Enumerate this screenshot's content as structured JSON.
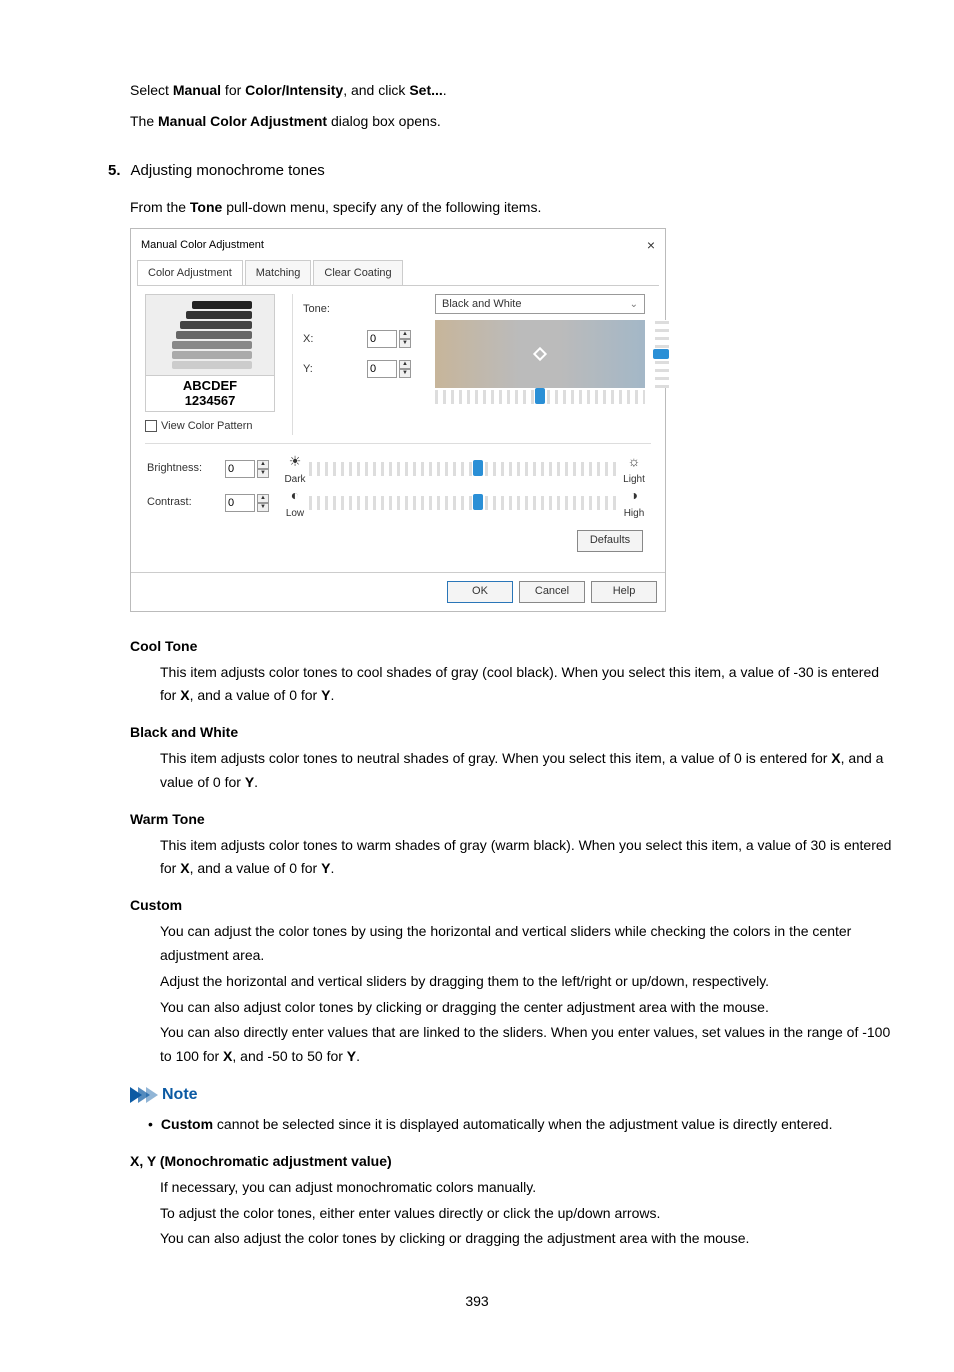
{
  "intro": {
    "line1_pre": "Select ",
    "line1_b1": "Manual",
    "line1_mid": " for ",
    "line1_b2": "Color/Intensity",
    "line1_mid2": ", and click ",
    "line1_b3": "Set...",
    "line1_end": ".",
    "line2_pre": "The ",
    "line2_b1": "Manual Color Adjustment",
    "line2_end": " dialog box opens."
  },
  "step": {
    "num": "5.",
    "title": "Adjusting monochrome tones",
    "desc_pre": "From the ",
    "desc_b": "Tone",
    "desc_end": " pull-down menu, specify any of the following items."
  },
  "dialog": {
    "title": "Manual Color Adjustment",
    "tabs": [
      "Color Adjustment",
      "Matching",
      "Clear Coating"
    ],
    "labels": {
      "tone": "Tone:",
      "x": "X:",
      "y": "Y:",
      "brightness": "Brightness:",
      "contrast": "Contrast:",
      "view_pattern": "View Color Pattern",
      "dark": "Dark",
      "light": "Light",
      "low": "Low",
      "high": "High"
    },
    "tone_value": "Black and White",
    "x_value": "0",
    "y_value": "0",
    "brightness_value": "0",
    "contrast_value": "0",
    "preview_l1": "ABCDEF",
    "preview_l2": "1234567",
    "buttons": {
      "defaults": "Defaults",
      "ok": "OK",
      "cancel": "Cancel",
      "help": "Help"
    }
  },
  "defs": {
    "cool": {
      "term": "Cool Tone",
      "d_pre": "This item adjusts color tones to cool shades of gray (cool black). When you select this item, a value of -30 is entered for ",
      "d_b1": "X",
      "d_mid": ", and a value of 0 for ",
      "d_b2": "Y",
      "d_end": "."
    },
    "bw": {
      "term": "Black and White",
      "d_pre": "This item adjusts color tones to neutral shades of gray. When you select this item, a value of 0 is entered for ",
      "d_b1": "X",
      "d_mid": ", and a value of 0 for ",
      "d_b2": "Y",
      "d_end": "."
    },
    "warm": {
      "term": "Warm Tone",
      "d_pre": "This item adjusts color tones to warm shades of gray (warm black). When you select this item, a value of 30 is entered for ",
      "d_b1": "X",
      "d_mid": ", and a value of 0 for ",
      "d_b2": "Y",
      "d_end": "."
    },
    "custom": {
      "term": "Custom",
      "p1": "You can adjust the color tones by using the horizontal and vertical sliders while checking the colors in the center adjustment area.",
      "p2": "Adjust the horizontal and vertical sliders by dragging them to the left/right or up/down, respectively.",
      "p3": "You can also adjust color tones by clicking or dragging the center adjustment area with the mouse.",
      "p4_pre": "You can also directly enter values that are linked to the sliders. When you enter values, set values in the range of -100 to 100 for ",
      "p4_b1": "X",
      "p4_mid": ", and -50 to 50 for ",
      "p4_b2": "Y",
      "p4_end": "."
    },
    "note": {
      "head": "Note",
      "b_pre": "",
      "b_b1": "Custom",
      "b_end": " cannot be selected since it is displayed automatically when the adjustment value is directly entered."
    },
    "xy": {
      "term": "X, Y (Monochromatic adjustment value)",
      "p1": "If necessary, you can adjust monochromatic colors manually.",
      "p2": "To adjust the color tones, either enter values directly or click the up/down arrows.",
      "p3": "You can also adjust the color tones by clicking or dragging the adjustment area with the mouse."
    }
  },
  "page": "393"
}
